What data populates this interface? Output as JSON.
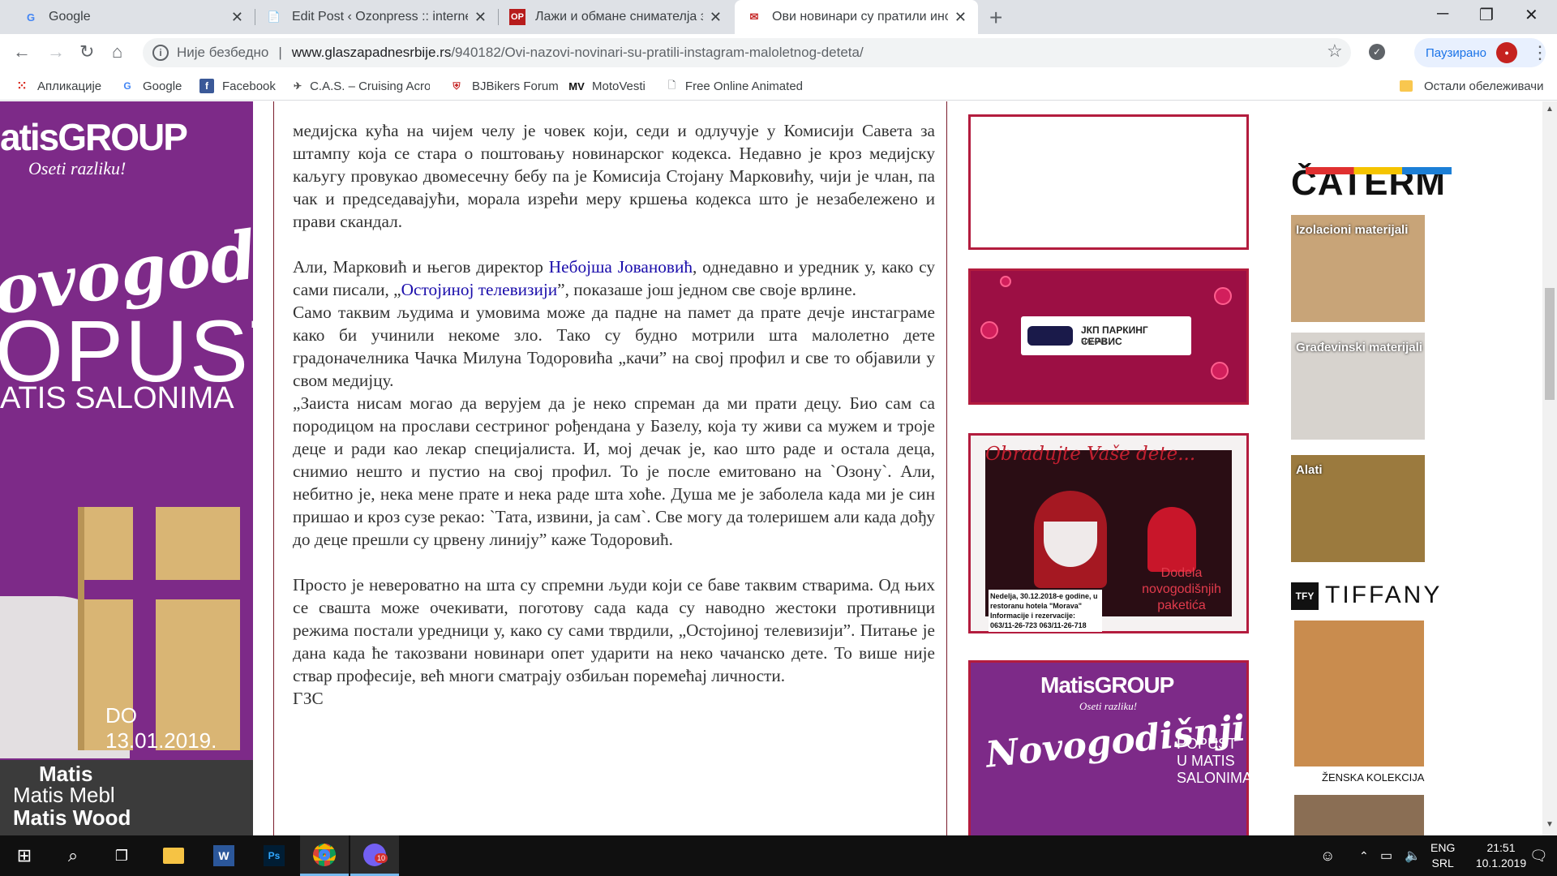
{
  "tabs": [
    {
      "title": "Google",
      "icon": "G",
      "active": false
    },
    {
      "title": "Edit Post ‹ Ozonpress :: internet p",
      "icon": "📄",
      "active": false
    },
    {
      "title": "Лажи и обмане снимателја за свадб",
      "icon": "OP",
      "active": false
    },
    {
      "title": "Ови новинари су пратили инстагр",
      "icon": "✉",
      "active": true
    }
  ],
  "toolbar": {
    "security": "Није безбедно",
    "url_domain": "www.glaszapadnesrbije.rs",
    "url_path": "/940182/Ovi-nazovi-novinari-su-pratili-instagram-maloletnog-deteta/",
    "profile_label": "Паузирано"
  },
  "bookmarks": [
    {
      "label": "Апликације"
    },
    {
      "label": "Google"
    },
    {
      "label": "Facebook"
    },
    {
      "label": "C.A.S. – Cruising Acro"
    },
    {
      "label": "BJBikers Forum"
    },
    {
      "label": "MotoVesti"
    },
    {
      "label": "Free Online Animated"
    },
    {
      "label": "Остали обележивачи"
    }
  ],
  "left_ad": {
    "brand": "atisGROUP",
    "tagline": "Oseti razliku!",
    "script": "ovogodišnji",
    "popust": "OPUST",
    "salonima": "ATIS SALONIMA",
    "date": "DO 13.01.2019.",
    "footer": [
      "Matis",
      "Matis Mebl",
      "Matis Wood"
    ]
  },
  "article": {
    "p1": " медијска кућа на чијем челу је човек који, седи и одлучује у Комисији Савета за штампу која се стара о поштовању новинарског кодекса. Недавно је кроз медијску каљугу провукао двомесечну бебу па је Комисија Стојану Марковићу, чији је члан, па чак и председавајући, морала изрећи меру кршења кодекса што је незабележено и прави скандал.",
    "p2_a": "Али, Марковић и његов директор ",
    "p2_link1": "Небојша Јовановић",
    "p2_b": ", однедавно и уредник у, како су сами писали, „",
    "p2_link2": "Остојиној телевизији",
    "p2_c": "”, показаше још једном све своје врлине.",
    "p3": "Само таквим људима и умовима може да падне на памет да прате дечје инстаграме како би учинили некоме зло. Тако су будно мотрили шта малолетно дете градоначелника Чачка Милуна Тодоровића „качи” на свој профил и све то објавили у свом медијцу.",
    "p4": "„Заиста нисам могао да верујем да је неко спреман да ми прати децу. Био сам са породицом на прослави сестриног рођендана у Базелу, која ту живи са мужем и троје деце и ради као лекар специјалиста. И, мој дечак је, као што раде и остала деца, снимио нешто и пустио на свој профил. То је после емитовано на `Озону`. Али, небитно је, нека мене прате и нека раде шта хоће. Душа ме је заболела када ми је син пришао и кроз сузе рекао: `Тата, извини, ја сам`. Све могу да толеришем али када дођу до деце прешли су црвену линију” каже Тодоровић.",
    "p5": "Просто је невероватно на шта су спремни људи који се баве таквим стварима. Од њих се свашта може очекивати, поготову сада када су наводно жестоки противници режима постали уредници у, како су сами тврдили, „Остојиној телевизији”. Питање је дана када ће такозвани новинари опет ударити на неко чачанско дете. То више није ствар професије, већ многи сматрају озбиљан поремећај личности.",
    "signature": "ГЗС"
  },
  "sidebar": {
    "parking_title": "ЈКП ПАРКИНГ СЕРВИС",
    "parking_city": "ЧАЧАК",
    "santa_heading": "Obradujte Vaše dete...",
    "santa_text": "Dodela novogodišnjih paketića",
    "santa_small": "Nedelja, 30.12.2018-e godine, u restoranu hotela \"Morava\" Informacije i rezervacije: 063/11-26-723 063/11-26-718",
    "matis_brand": "MatisGROUP",
    "matis_tagline": "Oseti razliku!",
    "matis_script": "Novogodišnji",
    "matis_promo": "POPUST U MATIS SALONIMA"
  },
  "right_ad": {
    "caterm": "ČATERM",
    "tiles": [
      "Izolacioni materijali",
      "Građevinski materijali",
      "Alati"
    ],
    "tiffany": "TIFFANY",
    "tiffany_logo": "TFY",
    "zenska": "ŽENSKA KOLEKCIJA"
  },
  "taskbar": {
    "lang1": "ENG",
    "lang2": "SRL",
    "time": "21:51",
    "date": "10.1.2019",
    "badge": "10"
  }
}
